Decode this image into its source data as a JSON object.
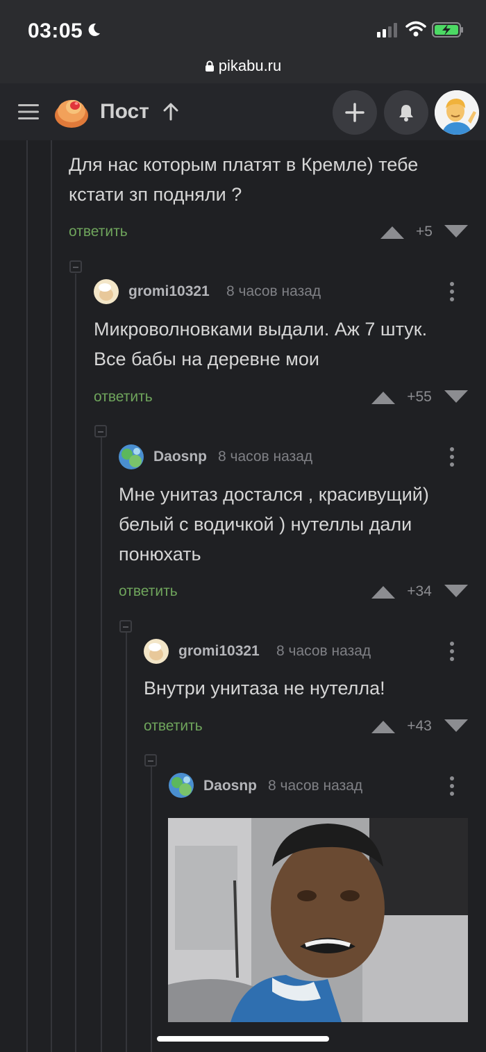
{
  "status_bar": {
    "time": "03:05",
    "url": "pikabu.ru"
  },
  "header": {
    "title": "Пост",
    "icons": [
      "menu-icon",
      "pikabu-logo",
      "arrow-up-icon",
      "plus-icon",
      "bell-icon",
      "user-avatar"
    ]
  },
  "comments": [
    {
      "text_lines": [
        "Для нас которым платят в Кремле) тебе",
        "кстати зп подняли ?"
      ],
      "reply": "ответить",
      "score": "+5"
    },
    {
      "author": "gromi10321",
      "time": "8 часов назад",
      "text_lines": [
        "Микроволновками выдали. Аж 7 штук.",
        "Все бабы на деревне мои"
      ],
      "reply": "ответить",
      "score": "+55"
    },
    {
      "author": "Daosnp",
      "time": "8 часов назад",
      "text_lines": [
        "Мне унитаз достался , красивущий)",
        "белый с водичкой ) нутеллы дали",
        "понюхать"
      ],
      "reply": "ответить",
      "score": "+34"
    },
    {
      "author": "gromi10321",
      "time": "8 часов назад",
      "text_lines": [
        "Внутри унитаза не нутелла!"
      ],
      "reply": "ответить",
      "score": "+43"
    },
    {
      "author": "Daosnp",
      "time": "8 часов назад",
      "image": "meme-image"
    }
  ],
  "colors": {
    "background": "#1f2023",
    "reply": "#6fa55c",
    "header": "#25262a"
  }
}
